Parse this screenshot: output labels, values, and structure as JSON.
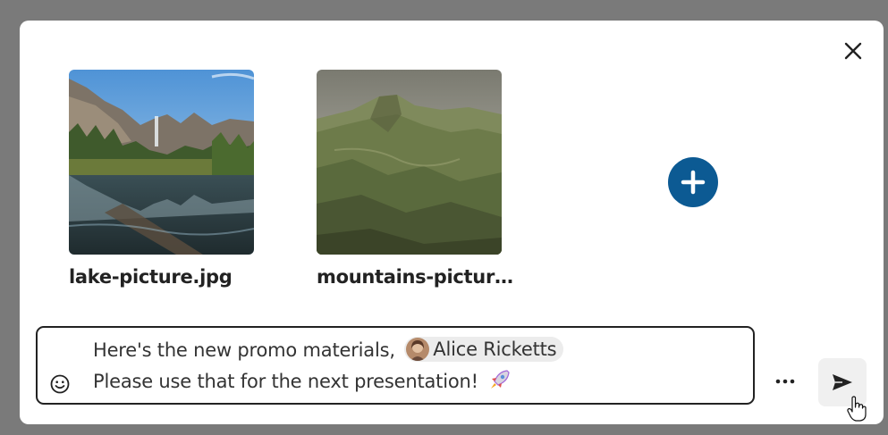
{
  "dialog": {
    "close_icon": "close-icon",
    "attachments": [
      {
        "filename": "lake-picture.jpg",
        "thumbnail": "lake landscape photo"
      },
      {
        "filename": "mountains-pictur…",
        "thumbnail": "green mountains photo"
      }
    ],
    "add_icon": "plus-circle-icon",
    "accent_color": "#0c5a93"
  },
  "composer": {
    "line1_text": "Here's the new promo materials,",
    "mention_name": "Alice Ricketts",
    "line2_text": "Please use that for the next presentation!",
    "emoji_icon": "smiley-icon",
    "rocket_icon": "rocket-icon"
  },
  "actions": {
    "more_icon": "more-icon",
    "send_icon": "send-icon"
  }
}
